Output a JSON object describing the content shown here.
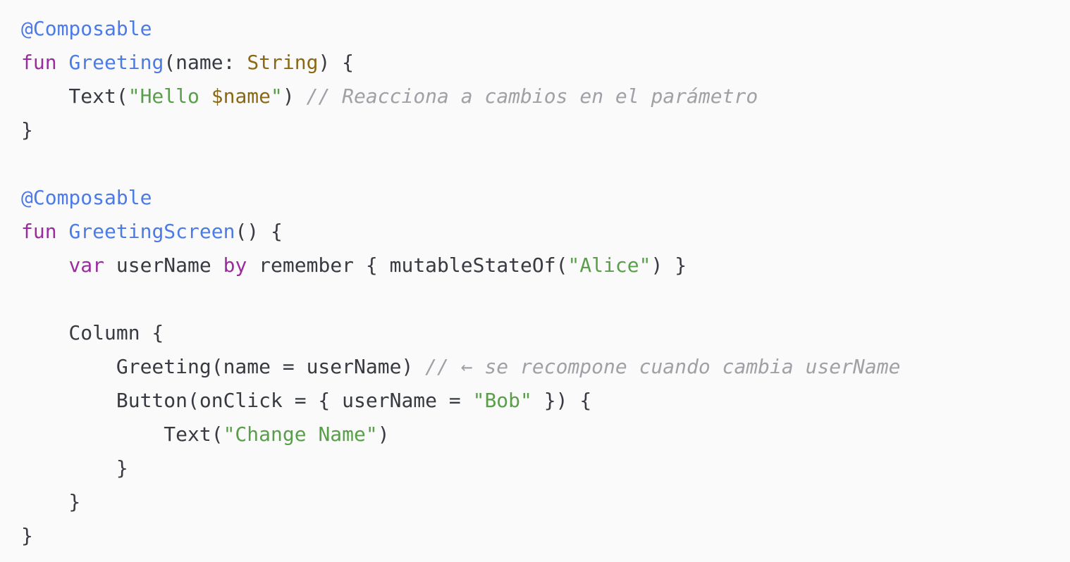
{
  "colors": {
    "background": "#fafafa",
    "annotation": "#4c7be5",
    "keyword": "#9a2c9e",
    "type": "#8b6914",
    "string": "#5a9e4b",
    "comment": "#a0a1a7",
    "text": "#383a42"
  },
  "code_lines": [
    [
      {
        "t": "@Composable",
        "k": "ann"
      }
    ],
    [
      {
        "t": "fun",
        "k": "kw"
      },
      {
        "t": " ",
        "k": "plain"
      },
      {
        "t": "Greeting",
        "k": "fn"
      },
      {
        "t": "(name: ",
        "k": "plain"
      },
      {
        "t": "String",
        "k": "type"
      },
      {
        "t": ") {",
        "k": "plain"
      }
    ],
    [
      {
        "t": "    Text(",
        "k": "plain"
      },
      {
        "t": "\"Hello ",
        "k": "str"
      },
      {
        "t": "$name",
        "k": "interp"
      },
      {
        "t": "\"",
        "k": "str"
      },
      {
        "t": ") ",
        "k": "plain"
      },
      {
        "t": "// Reacciona a cambios en el parámetro",
        "k": "com"
      }
    ],
    [
      {
        "t": "}",
        "k": "plain"
      }
    ],
    [],
    [
      {
        "t": "@Composable",
        "k": "ann"
      }
    ],
    [
      {
        "t": "fun",
        "k": "kw"
      },
      {
        "t": " ",
        "k": "plain"
      },
      {
        "t": "GreetingScreen",
        "k": "fn"
      },
      {
        "t": "() {",
        "k": "plain"
      }
    ],
    [
      {
        "t": "    ",
        "k": "plain"
      },
      {
        "t": "var",
        "k": "kw"
      },
      {
        "t": " userName ",
        "k": "plain"
      },
      {
        "t": "by",
        "k": "kw"
      },
      {
        "t": " remember { mutableStateOf(",
        "k": "plain"
      },
      {
        "t": "\"Alice\"",
        "k": "str"
      },
      {
        "t": ") }",
        "k": "plain"
      }
    ],
    [],
    [
      {
        "t": "    Column {",
        "k": "plain"
      }
    ],
    [
      {
        "t": "        Greeting(name = userName) ",
        "k": "plain"
      },
      {
        "t": "// ← se recompone cuando cambia userName",
        "k": "com"
      }
    ],
    [
      {
        "t": "        Button(onClick = { userName = ",
        "k": "plain"
      },
      {
        "t": "\"Bob\"",
        "k": "str"
      },
      {
        "t": " }) {",
        "k": "plain"
      }
    ],
    [
      {
        "t": "            Text(",
        "k": "plain"
      },
      {
        "t": "\"Change Name\"",
        "k": "str"
      },
      {
        "t": ")",
        "k": "plain"
      }
    ],
    [
      {
        "t": "        }",
        "k": "plain"
      }
    ],
    [
      {
        "t": "    }",
        "k": "plain"
      }
    ],
    [
      {
        "t": "}",
        "k": "plain"
      }
    ]
  ]
}
